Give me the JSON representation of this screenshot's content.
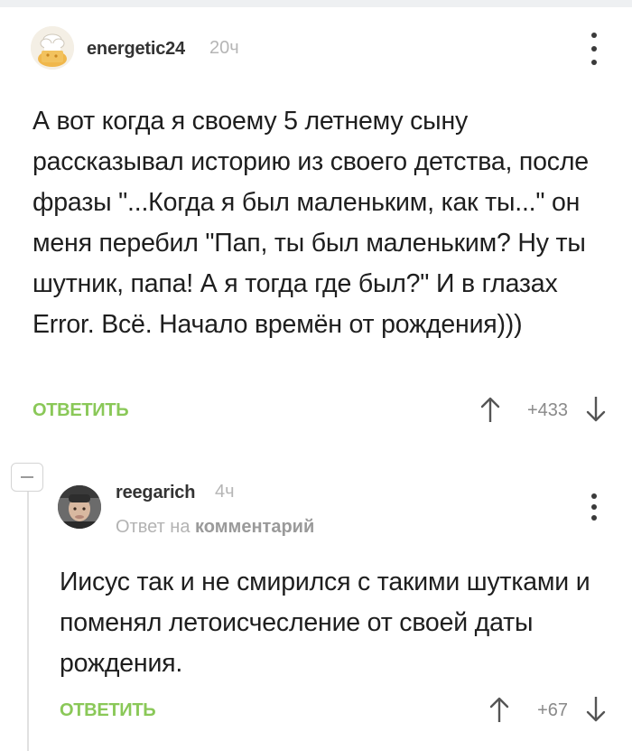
{
  "comment": {
    "author": "energetic24",
    "time": "20ч",
    "text": "А вот когда я своему 5 летнему сыну рассказывал историю из своего детства, после фразы \"...Когда я был маленьким, как ты...\" он меня перебил \"Пап, ты был маленьким? Ну ты шутник, папа! А я тогда где был?\" И в глазах Error. Всё. Начало времён от рождения)))",
    "reply_label": "ОТВЕТИТЬ",
    "score": "+433"
  },
  "reply": {
    "author": "reegarich",
    "time": "4ч",
    "reply_to_prefix": "Ответ на",
    "reply_to_link": "комментарий",
    "text": "Иисус так и не смирился с такими шутками и поменял летоисчесление от своей даты рождения.",
    "reply_label": "ОТВЕТИТЬ",
    "score": "+67"
  },
  "icons": {
    "menu": "more-vertical-icon",
    "vote_up": "arrow-up-icon",
    "vote_down": "arrow-down-icon",
    "collapse": "minus-icon"
  },
  "colors": {
    "accent_green": "#8ac858",
    "muted_gray": "#b5b5b5",
    "text": "#1e1e1e"
  }
}
